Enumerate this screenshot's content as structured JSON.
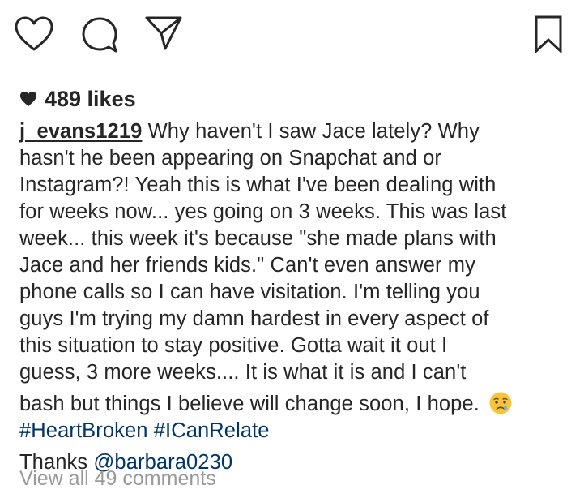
{
  "actions": {
    "like_icon": "heart-outline-icon",
    "comment_icon": "speech-bubble-icon",
    "share_icon": "paper-plane-icon",
    "save_icon": "bookmark-icon"
  },
  "post": {
    "likes_label": "489 likes",
    "username": "j_evans1219",
    "caption_lines": [
      " Why haven't I saw Jace lately? Why",
      "hasn't he been appearing on Snapchat and or",
      "Instagram?! Yeah this is what I've been dealing with",
      "for weeks now... yes going on 3 weeks. This was last",
      "week... this week it's because \"she made plans with",
      "Jace and her friends kids.\" Can't even answer my",
      "phone calls so I can have visitation. I'm telling you",
      "guys I'm trying my damn hardest in every aspect of",
      "this situation to stay positive. Gotta wait it out I",
      "guess, 3 more weeks.... It is what it is and I can't",
      "bash but things I believe will change soon, I hope. "
    ],
    "emoji": "crying-face-emoji",
    "hashtags": [
      "#HeartBroken",
      "#ICanRelate"
    ],
    "thanks_text": "Thanks ",
    "mention": "@barbara0230",
    "view_comments_label": "View all 49 comments"
  },
  "colors": {
    "text": "#262626",
    "link": "#003569",
    "muted": "#999999"
  }
}
